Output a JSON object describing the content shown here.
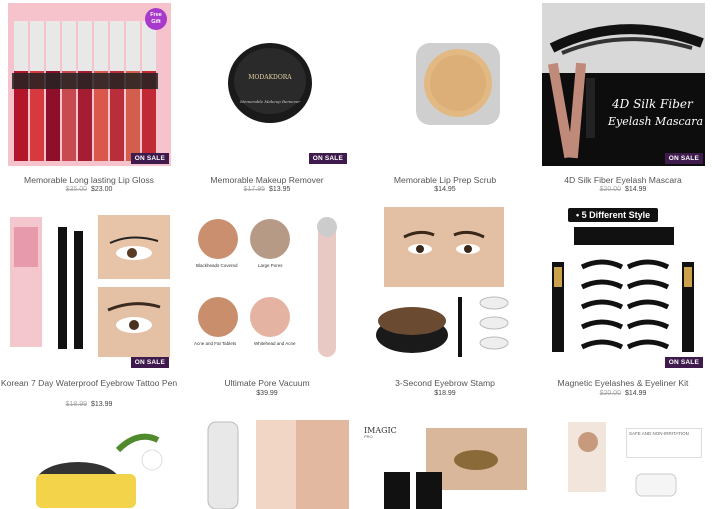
{
  "products": [
    {
      "title": "Memorable Long lasting Lip Gloss",
      "old_price": "$35.00",
      "price": "$23.00",
      "badge": "ON SALE",
      "free_gift": "Free Gift"
    },
    {
      "title": "Memorable Makeup Remover",
      "old_price": "$17.95",
      "price": "$13.95",
      "badge": "ON SALE",
      "jar_brand": "MODAKDORA",
      "jar_sub": "Memorable Makeup Remover"
    },
    {
      "title": "Memorable Lip Prep Scrub",
      "old_price": "",
      "price": "$14.95",
      "badge": ""
    },
    {
      "title": "4D Silk Fiber Eyelash Mascara",
      "old_price": "$20.00",
      "price": "$14.99",
      "badge": "ON SALE",
      "banner_line1": "4D Silk Fiber",
      "banner_line2": "Eyelash Mascara"
    },
    {
      "title": "Korean 7 Day Waterproof Eyebrow Tattoo Pen",
      "old_price": "$18.99",
      "price": "$13.99",
      "badge": "ON SALE"
    },
    {
      "title": "Ultimate Pore Vacuum",
      "old_price": "",
      "price": "$39.99",
      "badge": "",
      "labels": [
        "Blackheads Covered",
        "Large Pores",
        "Acne and Fat Tablets",
        "Whitehead and Acne"
      ]
    },
    {
      "title": "3-Second Eyebrow Stamp",
      "old_price": "",
      "price": "$18.99",
      "badge": ""
    },
    {
      "title": "Magnetic Eyelashes & Eyeliner Kit",
      "old_price": "$20.00",
      "price": "$14.99",
      "badge": "ON SALE",
      "style_pill": "• 5 Different Style"
    },
    {
      "title": "",
      "old_price": "",
      "price": "",
      "badge": ""
    },
    {
      "title": "",
      "old_price": "",
      "price": "",
      "badge": ""
    },
    {
      "title": "",
      "old_price": "",
      "price": "",
      "badge": "",
      "brand": "IMAGIC",
      "brand_sub": "PRO"
    },
    {
      "title": "",
      "old_price": "",
      "price": "",
      "badge": "",
      "note": "SAFE AND NON-IRRITATION"
    }
  ],
  "colors": {
    "badge_bg": "#3f1b4d",
    "free_gift": "#a83acb",
    "text": "#555555"
  }
}
